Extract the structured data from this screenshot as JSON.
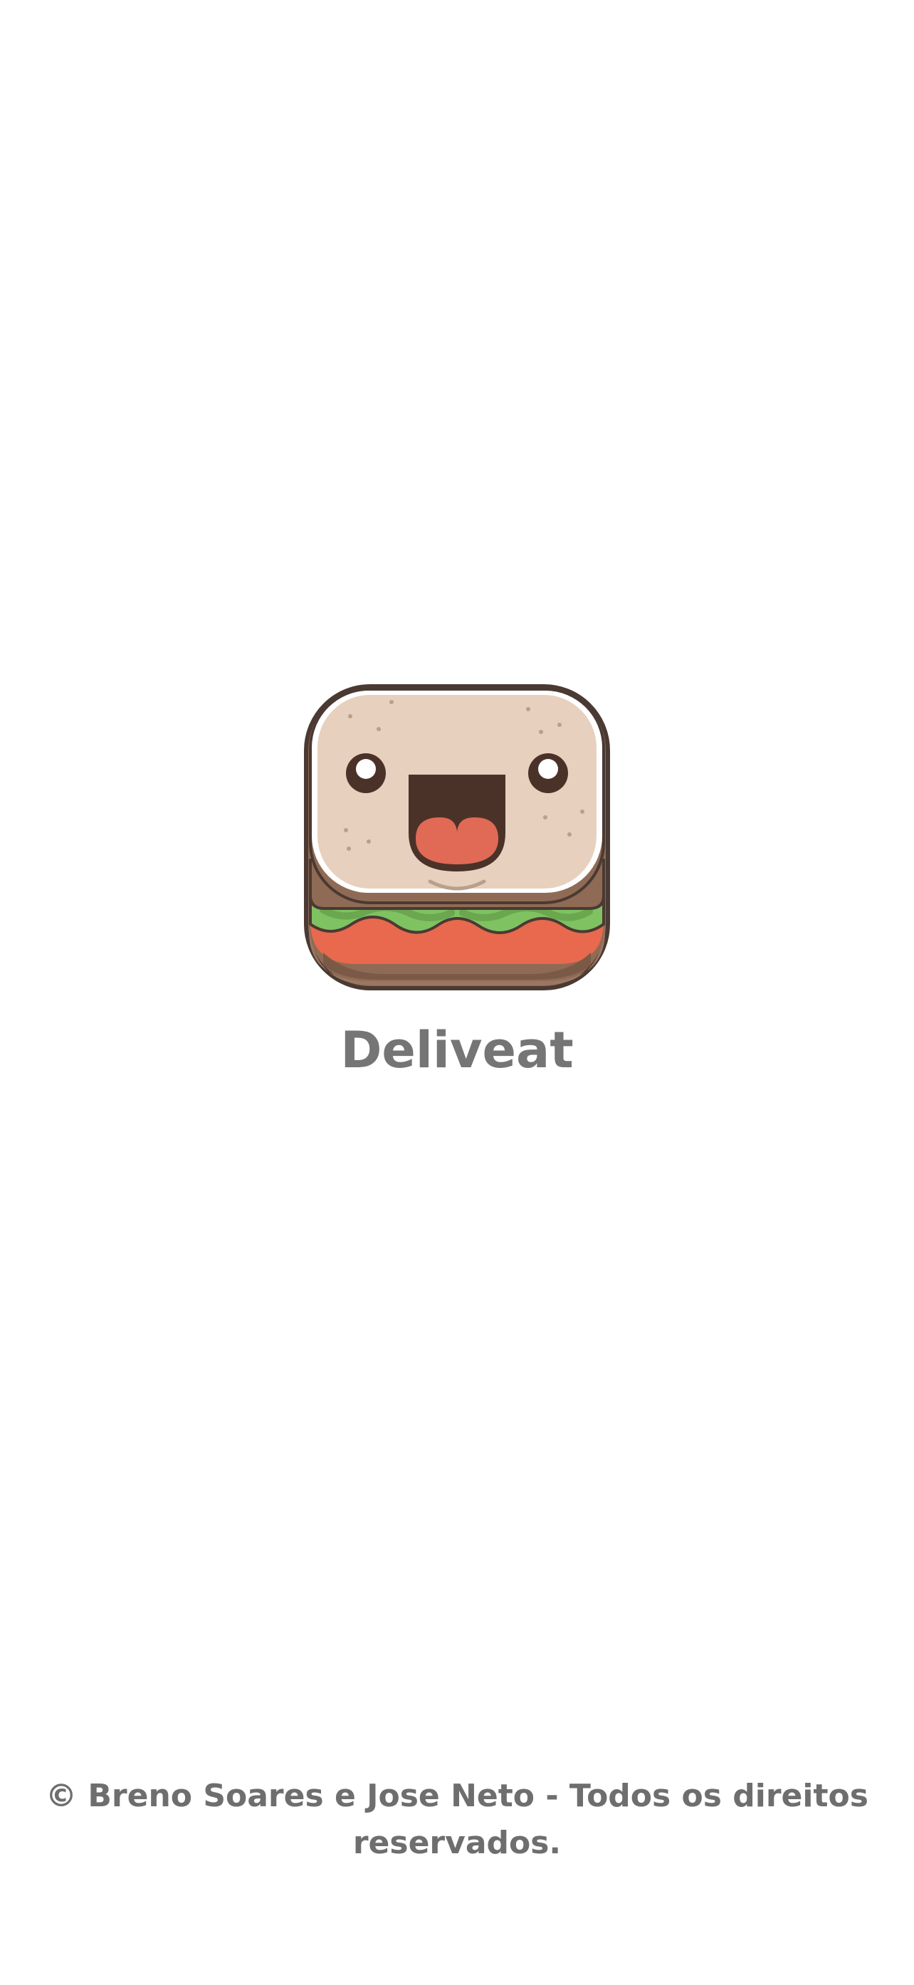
{
  "app": {
    "logo_icon": "smiling-sandwich-logo-icon",
    "name": "Deliveat"
  },
  "footer": {
    "copyright": "© Breno Soares e Jose Neto - Todos os direitos reservados."
  },
  "colors": {
    "background": "#ffffff",
    "text": "#757575",
    "bread_top": "#e7d0bd",
    "bread_crust": "#8c6a54",
    "outline": "#4a3a33",
    "lettuce": "#7fc262",
    "tomato": "#e8694d",
    "mouth": "#4b3229",
    "tongue": "#e06a55"
  }
}
